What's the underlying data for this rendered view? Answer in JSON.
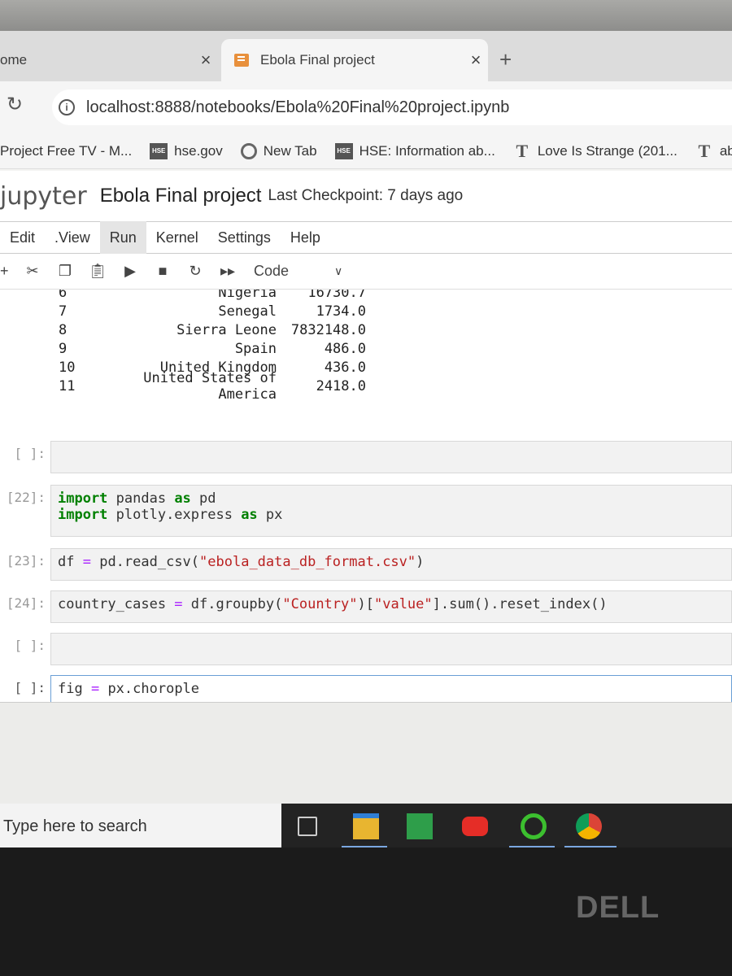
{
  "browser": {
    "tabs": [
      {
        "title": "ome",
        "active": false
      },
      {
        "title": "Ebola Final project",
        "active": true
      }
    ],
    "close_glyph": "×",
    "newtab_glyph": "+",
    "url": "localhost:8888/notebooks/Ebola%20Final%20project.ipynb",
    "bookmarks": [
      {
        "label": "Project Free TV - M...",
        "icon": "none"
      },
      {
        "label": "hse.gov",
        "icon": "hse-icon"
      },
      {
        "label": "New Tab",
        "icon": "chrome-icon"
      },
      {
        "label": "HSE: Information ab...",
        "icon": "hse-icon"
      },
      {
        "label": "Love Is Strange (201...",
        "icon": "t-icon"
      },
      {
        "label": "abo",
        "icon": "t-icon"
      }
    ]
  },
  "jupyter": {
    "logo": "jupyter",
    "notebook_name": "Ebola Final project",
    "checkpoint": "Last Checkpoint: 7 days ago",
    "menu": [
      "Edit",
      ".View",
      "Run",
      "Kernel",
      "Settings",
      "Help"
    ],
    "cell_type": "Code"
  },
  "output_table": [
    {
      "idx": "6",
      "country": "Nigeria",
      "value": "16730.7"
    },
    {
      "idx": "7",
      "country": "Senegal",
      "value": "1734.0"
    },
    {
      "idx": "8",
      "country": "Sierra Leone",
      "value": "7832148.0"
    },
    {
      "idx": "9",
      "country": "Spain",
      "value": "486.0"
    },
    {
      "idx": "10",
      "country": "United Kingdom",
      "value": "436.0"
    },
    {
      "idx": "11",
      "country": "United States of America",
      "value": "2418.0"
    }
  ],
  "cells": [
    {
      "prompt": "[ ]:",
      "code": ""
    },
    {
      "prompt": "[22]:",
      "lines": [
        [
          {
            "t": "import",
            "c": "kw"
          },
          {
            "t": " pandas ",
            "c": ""
          },
          {
            "t": "as",
            "c": "kw"
          },
          {
            "t": " pd",
            "c": ""
          }
        ],
        [
          {
            "t": "import",
            "c": "kw"
          },
          {
            "t": " plotly.express ",
            "c": ""
          },
          {
            "t": "as",
            "c": "kw"
          },
          {
            "t": " px",
            "c": ""
          }
        ]
      ]
    },
    {
      "prompt": "[23]:",
      "lines": [
        [
          {
            "t": "df ",
            "c": ""
          },
          {
            "t": "=",
            "c": "op"
          },
          {
            "t": " pd.read_csv(",
            "c": ""
          },
          {
            "t": "\"ebola_data_db_format.csv\"",
            "c": "str"
          },
          {
            "t": ")",
            "c": ""
          }
        ]
      ]
    },
    {
      "prompt": "[24]:",
      "lines": [
        [
          {
            "t": "country_cases ",
            "c": ""
          },
          {
            "t": "=",
            "c": "op"
          },
          {
            "t": " df.groupby(",
            "c": ""
          },
          {
            "t": "\"Country\"",
            "c": "str"
          },
          {
            "t": ")[",
            "c": ""
          },
          {
            "t": "\"value\"",
            "c": "str"
          },
          {
            "t": "].sum().reset_index()",
            "c": ""
          }
        ]
      ]
    },
    {
      "prompt": "[ ]:",
      "code": ""
    },
    {
      "prompt": "[ ]:",
      "lines": [
        [
          {
            "t": "fig ",
            "c": ""
          },
          {
            "t": "=",
            "c": "op"
          },
          {
            "t": " px.chorople",
            "c": ""
          }
        ]
      ]
    }
  ],
  "taskbar": {
    "search_placeholder": "Type here to search"
  },
  "laptop_brand": "DELL"
}
